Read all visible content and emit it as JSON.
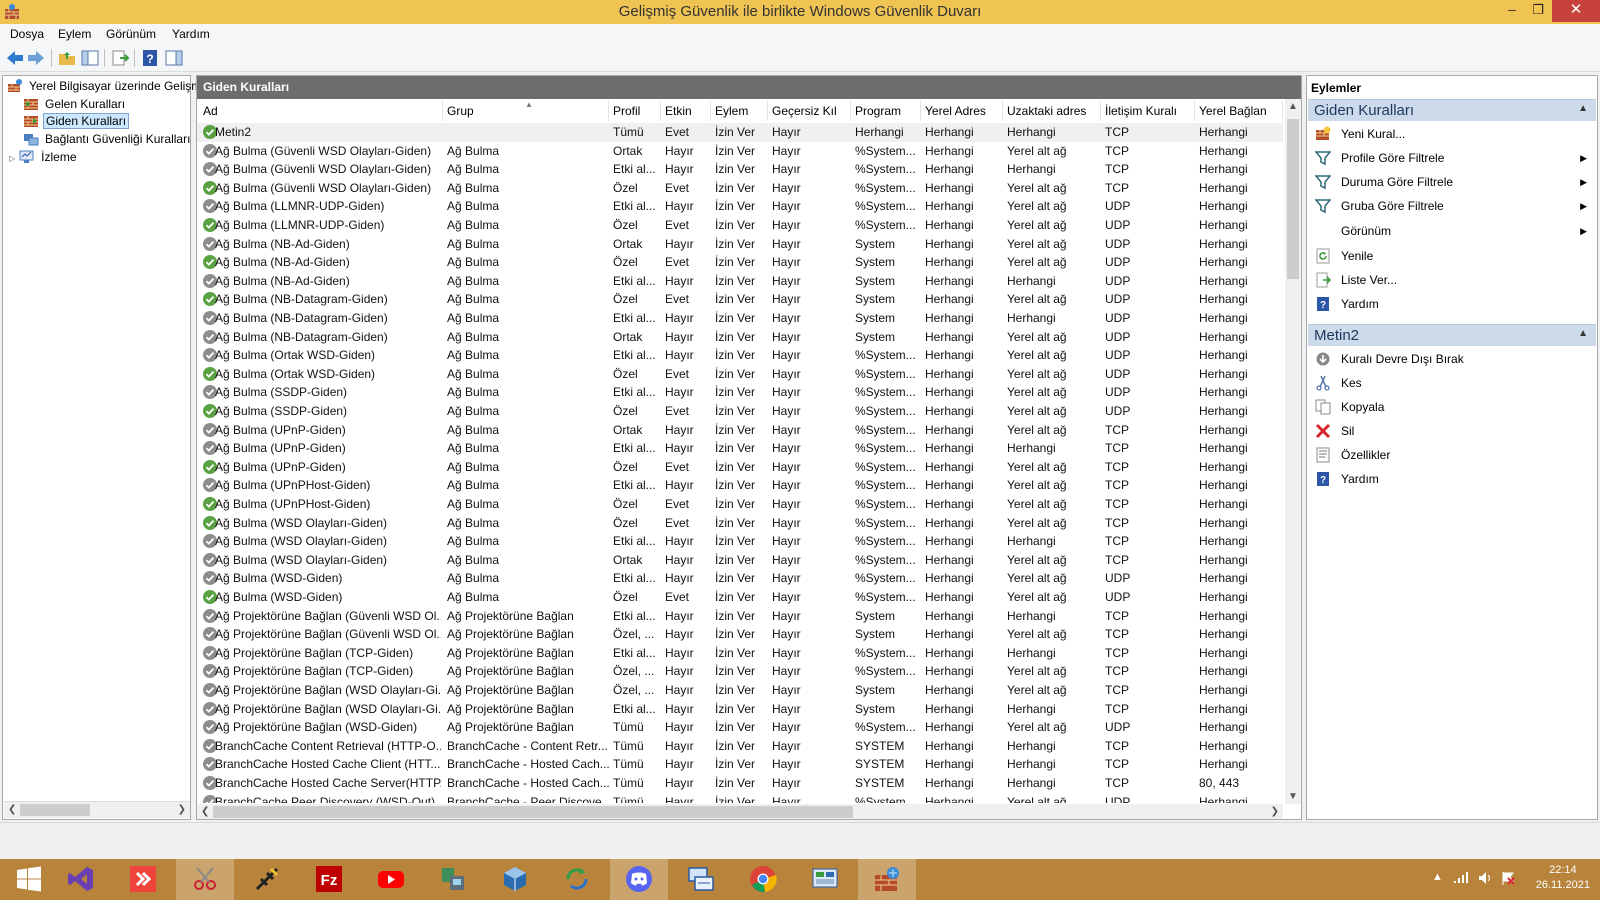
{
  "window": {
    "title": "Gelişmiş Güvenlik ile birlikte Windows Güvenlik Duvarı",
    "min": "–",
    "max": "❐",
    "close": "✕"
  },
  "menu": [
    "Dosya",
    "Eylem",
    "Görünüm",
    "Yardım"
  ],
  "tree": {
    "root": "Yerel Bilgisayar üzerinde Gelişmi",
    "inbound": "Gelen Kuralları",
    "outbound": "Giden Kuralları",
    "connection": "Bağlantı Güvenliği Kuralları",
    "monitoring": "İzleme"
  },
  "center": {
    "header": "Giden Kuralları",
    "columns": [
      "Ad",
      "Grup",
      "Profil",
      "Etkin",
      "Eylem",
      "Geçersiz Kıl",
      "Program",
      "Yerel Adres",
      "Uzaktaki adres",
      "İletişim Kuralı",
      "Yerel Bağlan"
    ],
    "rows": [
      {
        "enabled": true,
        "name": "Metin2",
        "group": "",
        "profile": "Tümü",
        "active": "Evet",
        "action": "İzin Ver",
        "override": "Hayır",
        "program": "Herhangi",
        "local": "Herhangi",
        "remote": "Herhangi",
        "proto": "TCP",
        "lport": "Herhangi"
      },
      {
        "enabled": false,
        "name": "Ağ Bulma (Güvenli WSD Olayları-Giden)",
        "group": "Ağ Bulma",
        "profile": "Ortak",
        "active": "Hayır",
        "action": "İzin Ver",
        "override": "Hayır",
        "program": "%System...",
        "local": "Herhangi",
        "remote": "Yerel alt ağ",
        "proto": "TCP",
        "lport": "Herhangi"
      },
      {
        "enabled": false,
        "name": "Ağ Bulma (Güvenli WSD Olayları-Giden)",
        "group": "Ağ Bulma",
        "profile": "Etki al...",
        "active": "Hayır",
        "action": "İzin Ver",
        "override": "Hayır",
        "program": "%System...",
        "local": "Herhangi",
        "remote": "Herhangi",
        "proto": "TCP",
        "lport": "Herhangi"
      },
      {
        "enabled": true,
        "name": "Ağ Bulma (Güvenli WSD Olayları-Giden)",
        "group": "Ağ Bulma",
        "profile": "Özel",
        "active": "Evet",
        "action": "İzin Ver",
        "override": "Hayır",
        "program": "%System...",
        "local": "Herhangi",
        "remote": "Yerel alt ağ",
        "proto": "TCP",
        "lport": "Herhangi"
      },
      {
        "enabled": false,
        "name": "Ağ Bulma (LLMNR-UDP-Giden)",
        "group": "Ağ Bulma",
        "profile": "Etki al...",
        "active": "Hayır",
        "action": "İzin Ver",
        "override": "Hayır",
        "program": "%System...",
        "local": "Herhangi",
        "remote": "Yerel alt ağ",
        "proto": "UDP",
        "lport": "Herhangi"
      },
      {
        "enabled": true,
        "name": "Ağ Bulma (LLMNR-UDP-Giden)",
        "group": "Ağ Bulma",
        "profile": "Özel",
        "active": "Evet",
        "action": "İzin Ver",
        "override": "Hayır",
        "program": "%System...",
        "local": "Herhangi",
        "remote": "Yerel alt ağ",
        "proto": "UDP",
        "lport": "Herhangi"
      },
      {
        "enabled": false,
        "name": "Ağ Bulma (NB-Ad-Giden)",
        "group": "Ağ Bulma",
        "profile": "Ortak",
        "active": "Hayır",
        "action": "İzin Ver",
        "override": "Hayır",
        "program": "System",
        "local": "Herhangi",
        "remote": "Yerel alt ağ",
        "proto": "UDP",
        "lport": "Herhangi"
      },
      {
        "enabled": true,
        "name": "Ağ Bulma (NB-Ad-Giden)",
        "group": "Ağ Bulma",
        "profile": "Özel",
        "active": "Evet",
        "action": "İzin Ver",
        "override": "Hayır",
        "program": "System",
        "local": "Herhangi",
        "remote": "Yerel alt ağ",
        "proto": "UDP",
        "lport": "Herhangi"
      },
      {
        "enabled": false,
        "name": "Ağ Bulma (NB-Ad-Giden)",
        "group": "Ağ Bulma",
        "profile": "Etki al...",
        "active": "Hayır",
        "action": "İzin Ver",
        "override": "Hayır",
        "program": "System",
        "local": "Herhangi",
        "remote": "Herhangi",
        "proto": "UDP",
        "lport": "Herhangi"
      },
      {
        "enabled": true,
        "name": "Ağ Bulma (NB-Datagram-Giden)",
        "group": "Ağ Bulma",
        "profile": "Özel",
        "active": "Evet",
        "action": "İzin Ver",
        "override": "Hayır",
        "program": "System",
        "local": "Herhangi",
        "remote": "Yerel alt ağ",
        "proto": "UDP",
        "lport": "Herhangi"
      },
      {
        "enabled": false,
        "name": "Ağ Bulma (NB-Datagram-Giden)",
        "group": "Ağ Bulma",
        "profile": "Etki al...",
        "active": "Hayır",
        "action": "İzin Ver",
        "override": "Hayır",
        "program": "System",
        "local": "Herhangi",
        "remote": "Herhangi",
        "proto": "UDP",
        "lport": "Herhangi"
      },
      {
        "enabled": false,
        "name": "Ağ Bulma (NB-Datagram-Giden)",
        "group": "Ağ Bulma",
        "profile": "Ortak",
        "active": "Hayır",
        "action": "İzin Ver",
        "override": "Hayır",
        "program": "System",
        "local": "Herhangi",
        "remote": "Yerel alt ağ",
        "proto": "UDP",
        "lport": "Herhangi"
      },
      {
        "enabled": false,
        "name": "Ağ Bulma (Ortak WSD-Giden)",
        "group": "Ağ Bulma",
        "profile": "Etki al...",
        "active": "Hayır",
        "action": "İzin Ver",
        "override": "Hayır",
        "program": "%System...",
        "local": "Herhangi",
        "remote": "Yerel alt ağ",
        "proto": "UDP",
        "lport": "Herhangi"
      },
      {
        "enabled": true,
        "name": "Ağ Bulma (Ortak WSD-Giden)",
        "group": "Ağ Bulma",
        "profile": "Özel",
        "active": "Evet",
        "action": "İzin Ver",
        "override": "Hayır",
        "program": "%System...",
        "local": "Herhangi",
        "remote": "Yerel alt ağ",
        "proto": "UDP",
        "lport": "Herhangi"
      },
      {
        "enabled": false,
        "name": "Ağ Bulma (SSDP-Giden)",
        "group": "Ağ Bulma",
        "profile": "Etki al...",
        "active": "Hayır",
        "action": "İzin Ver",
        "override": "Hayır",
        "program": "%System...",
        "local": "Herhangi",
        "remote": "Yerel alt ağ",
        "proto": "UDP",
        "lport": "Herhangi"
      },
      {
        "enabled": true,
        "name": "Ağ Bulma (SSDP-Giden)",
        "group": "Ağ Bulma",
        "profile": "Özel",
        "active": "Evet",
        "action": "İzin Ver",
        "override": "Hayır",
        "program": "%System...",
        "local": "Herhangi",
        "remote": "Yerel alt ağ",
        "proto": "UDP",
        "lport": "Herhangi"
      },
      {
        "enabled": false,
        "name": "Ağ Bulma (UPnP-Giden)",
        "group": "Ağ Bulma",
        "profile": "Ortak",
        "active": "Hayır",
        "action": "İzin Ver",
        "override": "Hayır",
        "program": "%System...",
        "local": "Herhangi",
        "remote": "Yerel alt ağ",
        "proto": "TCP",
        "lport": "Herhangi"
      },
      {
        "enabled": false,
        "name": "Ağ Bulma (UPnP-Giden)",
        "group": "Ağ Bulma",
        "profile": "Etki al...",
        "active": "Hayır",
        "action": "İzin Ver",
        "override": "Hayır",
        "program": "%System...",
        "local": "Herhangi",
        "remote": "Herhangi",
        "proto": "TCP",
        "lport": "Herhangi"
      },
      {
        "enabled": true,
        "name": "Ağ Bulma (UPnP-Giden)",
        "group": "Ağ Bulma",
        "profile": "Özel",
        "active": "Evet",
        "action": "İzin Ver",
        "override": "Hayır",
        "program": "%System...",
        "local": "Herhangi",
        "remote": "Yerel alt ağ",
        "proto": "TCP",
        "lport": "Herhangi"
      },
      {
        "enabled": false,
        "name": "Ağ Bulma (UPnPHost-Giden)",
        "group": "Ağ Bulma",
        "profile": "Etki al...",
        "active": "Hayır",
        "action": "İzin Ver",
        "override": "Hayır",
        "program": "%System...",
        "local": "Herhangi",
        "remote": "Yerel alt ağ",
        "proto": "TCP",
        "lport": "Herhangi"
      },
      {
        "enabled": true,
        "name": "Ağ Bulma (UPnPHost-Giden)",
        "group": "Ağ Bulma",
        "profile": "Özel",
        "active": "Evet",
        "action": "İzin Ver",
        "override": "Hayır",
        "program": "%System...",
        "local": "Herhangi",
        "remote": "Yerel alt ağ",
        "proto": "TCP",
        "lport": "Herhangi"
      },
      {
        "enabled": true,
        "name": "Ağ Bulma (WSD Olayları-Giden)",
        "group": "Ağ Bulma",
        "profile": "Özel",
        "active": "Evet",
        "action": "İzin Ver",
        "override": "Hayır",
        "program": "%System...",
        "local": "Herhangi",
        "remote": "Yerel alt ağ",
        "proto": "TCP",
        "lport": "Herhangi"
      },
      {
        "enabled": false,
        "name": "Ağ Bulma (WSD Olayları-Giden)",
        "group": "Ağ Bulma",
        "profile": "Etki al...",
        "active": "Hayır",
        "action": "İzin Ver",
        "override": "Hayır",
        "program": "%System...",
        "local": "Herhangi",
        "remote": "Herhangi",
        "proto": "TCP",
        "lport": "Herhangi"
      },
      {
        "enabled": false,
        "name": "Ağ Bulma (WSD Olayları-Giden)",
        "group": "Ağ Bulma",
        "profile": "Ortak",
        "active": "Hayır",
        "action": "İzin Ver",
        "override": "Hayır",
        "program": "%System...",
        "local": "Herhangi",
        "remote": "Yerel alt ağ",
        "proto": "TCP",
        "lport": "Herhangi"
      },
      {
        "enabled": false,
        "name": "Ağ Bulma (WSD-Giden)",
        "group": "Ağ Bulma",
        "profile": "Etki al...",
        "active": "Hayır",
        "action": "İzin Ver",
        "override": "Hayır",
        "program": "%System...",
        "local": "Herhangi",
        "remote": "Yerel alt ağ",
        "proto": "UDP",
        "lport": "Herhangi"
      },
      {
        "enabled": true,
        "name": "Ağ Bulma (WSD-Giden)",
        "group": "Ağ Bulma",
        "profile": "Özel",
        "active": "Evet",
        "action": "İzin Ver",
        "override": "Hayır",
        "program": "%System...",
        "local": "Herhangi",
        "remote": "Yerel alt ağ",
        "proto": "UDP",
        "lport": "Herhangi"
      },
      {
        "enabled": false,
        "name": "Ağ Projektörüne Bağlan (Güvenli WSD Ol...",
        "group": "Ağ Projektörüne Bağlan",
        "profile": "Etki al...",
        "active": "Hayır",
        "action": "İzin Ver",
        "override": "Hayır",
        "program": "System",
        "local": "Herhangi",
        "remote": "Herhangi",
        "proto": "TCP",
        "lport": "Herhangi"
      },
      {
        "enabled": false,
        "name": "Ağ Projektörüne Bağlan (Güvenli WSD Ol...",
        "group": "Ağ Projektörüne Bağlan",
        "profile": "Özel, ...",
        "active": "Hayır",
        "action": "İzin Ver",
        "override": "Hayır",
        "program": "System",
        "local": "Herhangi",
        "remote": "Yerel alt ağ",
        "proto": "TCP",
        "lport": "Herhangi"
      },
      {
        "enabled": false,
        "name": "Ağ Projektörüne Bağlan (TCP-Giden)",
        "group": "Ağ Projektörüne Bağlan",
        "profile": "Etki al...",
        "active": "Hayır",
        "action": "İzin Ver",
        "override": "Hayır",
        "program": "%System...",
        "local": "Herhangi",
        "remote": "Herhangi",
        "proto": "TCP",
        "lport": "Herhangi"
      },
      {
        "enabled": false,
        "name": "Ağ Projektörüne Bağlan (TCP-Giden)",
        "group": "Ağ Projektörüne Bağlan",
        "profile": "Özel, ...",
        "active": "Hayır",
        "action": "İzin Ver",
        "override": "Hayır",
        "program": "%System...",
        "local": "Herhangi",
        "remote": "Yerel alt ağ",
        "proto": "TCP",
        "lport": "Herhangi"
      },
      {
        "enabled": false,
        "name": "Ağ Projektörüne Bağlan (WSD Olayları-Gi...",
        "group": "Ağ Projektörüne Bağlan",
        "profile": "Özel, ...",
        "active": "Hayır",
        "action": "İzin Ver",
        "override": "Hayır",
        "program": "System",
        "local": "Herhangi",
        "remote": "Yerel alt ağ",
        "proto": "TCP",
        "lport": "Herhangi"
      },
      {
        "enabled": false,
        "name": "Ağ Projektörüne Bağlan (WSD Olayları-Gi...",
        "group": "Ağ Projektörüne Bağlan",
        "profile": "Etki al...",
        "active": "Hayır",
        "action": "İzin Ver",
        "override": "Hayır",
        "program": "System",
        "local": "Herhangi",
        "remote": "Herhangi",
        "proto": "TCP",
        "lport": "Herhangi"
      },
      {
        "enabled": false,
        "name": "Ağ Projektörüne Bağlan (WSD-Giden)",
        "group": "Ağ Projektörüne Bağlan",
        "profile": "Tümü",
        "active": "Hayır",
        "action": "İzin Ver",
        "override": "Hayır",
        "program": "%System...",
        "local": "Herhangi",
        "remote": "Yerel alt ağ",
        "proto": "UDP",
        "lport": "Herhangi"
      },
      {
        "enabled": false,
        "name": "BranchCache Content Retrieval (HTTP-O...",
        "group": "BranchCache - Content Retr...",
        "profile": "Tümü",
        "active": "Hayır",
        "action": "İzin Ver",
        "override": "Hayır",
        "program": "SYSTEM",
        "local": "Herhangi",
        "remote": "Herhangi",
        "proto": "TCP",
        "lport": "Herhangi"
      },
      {
        "enabled": false,
        "name": "BranchCache Hosted Cache Client (HTT...",
        "group": "BranchCache - Hosted Cach...",
        "profile": "Tümü",
        "active": "Hayır",
        "action": "İzin Ver",
        "override": "Hayır",
        "program": "SYSTEM",
        "local": "Herhangi",
        "remote": "Herhangi",
        "proto": "TCP",
        "lport": "Herhangi"
      },
      {
        "enabled": false,
        "name": "BranchCache Hosted Cache Server(HTTP...",
        "group": "BranchCache - Hosted Cach...",
        "profile": "Tümü",
        "active": "Hayır",
        "action": "İzin Ver",
        "override": "Hayır",
        "program": "SYSTEM",
        "local": "Herhangi",
        "remote": "Herhangi",
        "proto": "TCP",
        "lport": "80, 443"
      },
      {
        "enabled": false,
        "name": "BranchCache Peer Discovery (WSD-Out)",
        "group": "BranchCache - Peer Discove...",
        "profile": "Tümü",
        "active": "Hayır",
        "action": "İzin Ver",
        "override": "Hayır",
        "program": "%System...",
        "local": "Herhangi",
        "remote": "Yerel alt ağ",
        "proto": "UDP",
        "lport": "Herhangi"
      }
    ]
  },
  "actions": {
    "title": "Eylemler",
    "section1": {
      "label": "Giden Kuralları",
      "items": [
        "Yeni Kural...",
        "Profile Göre Filtrele",
        "Duruma Göre Filtrele",
        "Gruba Göre Filtrele",
        "Görünüm",
        "Yenile",
        "Liste Ver...",
        "Yardım"
      ]
    },
    "section2": {
      "label": "Metin2",
      "items": [
        "Kuralı Devre Dışı Bırak",
        "Kes",
        "Kopyala",
        "Sil",
        "Özellikler",
        "Yardım"
      ]
    }
  },
  "taskbar": {
    "time": "22:14",
    "date": "26.11.2021",
    "apps": [
      "windows-start",
      "visual-studio",
      "anydesk",
      "snipping-tool",
      "app-launcher",
      "filezilla",
      "youtube",
      "network-tool",
      "virtualbox-3d",
      "refresh-app",
      "discord",
      "remote-desktop",
      "chrome",
      "control-panel",
      "firewall-active"
    ]
  },
  "colors": {
    "titlebar": "#f0c453",
    "taskbar": "#b8843c",
    "section_bg": "#ccdaeb",
    "enabled_icon": "#5aa144",
    "disabled_icon": "#8d8d8d"
  }
}
